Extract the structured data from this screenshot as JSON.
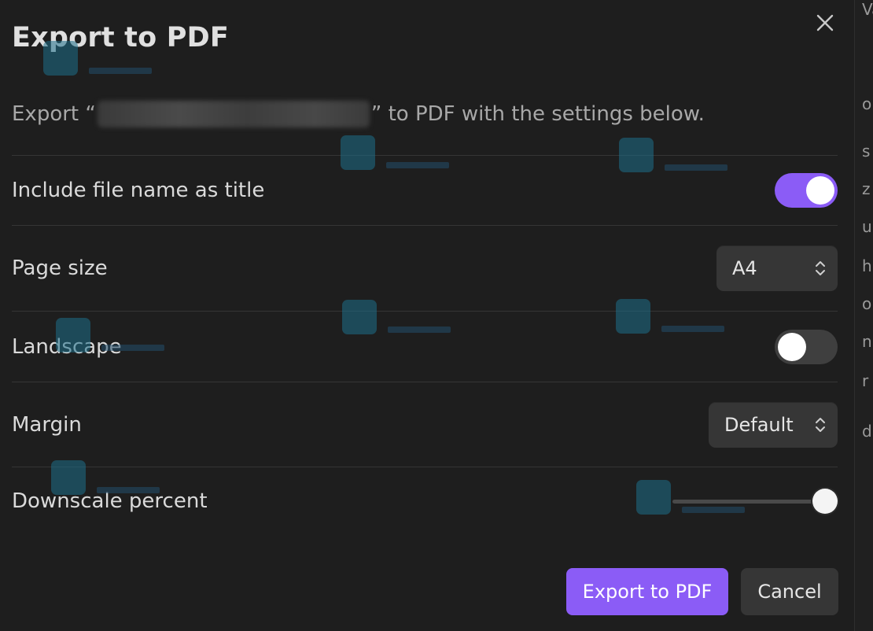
{
  "dialog": {
    "title": "Export to PDF",
    "description_prefix": "Export “",
    "description_suffix": "” to PDF with the settings below."
  },
  "settings": {
    "include_title": {
      "label": "Include file name as title",
      "enabled": true
    },
    "page_size": {
      "label": "Page size",
      "value": "A4"
    },
    "landscape": {
      "label": "Landscape",
      "enabled": false
    },
    "margin": {
      "label": "Margin",
      "value": "Default"
    },
    "downscale": {
      "label": "Downscale percent",
      "value_fraction": 1.0
    }
  },
  "buttons": {
    "export": "Export to PDF",
    "cancel": "Cancel"
  },
  "background_text": [
    "Va",
    "o",
    "s",
    "z",
    "u",
    "h",
    "o",
    "n",
    "r",
    "d"
  ],
  "colors": {
    "accent": "#8b5cf6",
    "background": "#1e1e1e",
    "control": "#363636"
  },
  "icons": [
    "close-icon",
    "chevron-updown-icon"
  ]
}
